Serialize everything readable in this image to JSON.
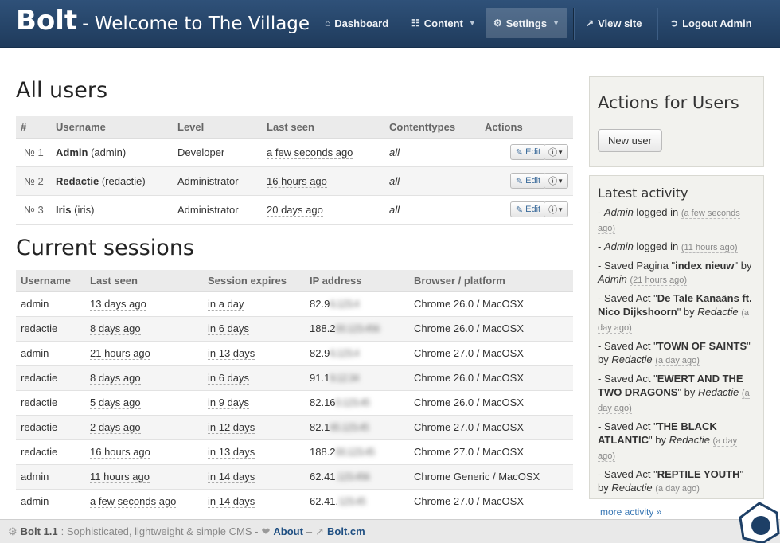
{
  "header": {
    "brand": "Bolt",
    "subtitle": "- Welcome to The Village",
    "nav": {
      "dashboard": "Dashboard",
      "content": "Content",
      "settings": "Settings",
      "view_site": "View site",
      "logout": "Logout Admin"
    }
  },
  "users": {
    "title": "All users",
    "columns": [
      "#",
      "Username",
      "Level",
      "Last seen",
      "Contenttypes",
      "Actions"
    ],
    "edit_label": "Edit",
    "rows": [
      {
        "num": "№ 1",
        "name": "Admin",
        "login": "(admin)",
        "level": "Developer",
        "last_seen": "a few seconds ago",
        "types": "all"
      },
      {
        "num": "№ 2",
        "name": "Redactie",
        "login": "(redactie)",
        "level": "Administrator",
        "last_seen": "16 hours ago",
        "types": "all"
      },
      {
        "num": "№ 3",
        "name": "Iris",
        "login": "(iris)",
        "level": "Administrator",
        "last_seen": "20 days ago",
        "types": "all"
      }
    ]
  },
  "sessions": {
    "title": "Current sessions",
    "columns": [
      "Username",
      "Last seen",
      "Session expires",
      "IP address",
      "Browser / platform"
    ],
    "rows": [
      {
        "user": "admin",
        "last_seen": "13 days ago",
        "expires": "in a day",
        "ip": "82.9",
        "ip_hidden": "6.123.4",
        "browser": "Chrome 26.0 / MacOSX"
      },
      {
        "user": "redactie",
        "last_seen": "8 days ago",
        "expires": "in 6 days",
        "ip": "188.2",
        "ip_hidden": "00.123.456",
        "browser": "Chrome 26.0 / MacOSX"
      },
      {
        "user": "admin",
        "last_seen": "21 hours ago",
        "expires": "in 13 days",
        "ip": "82.9",
        "ip_hidden": "6.123.4",
        "browser": "Chrome 27.0 / MacOSX"
      },
      {
        "user": "redactie",
        "last_seen": "8 days ago",
        "expires": "in 6 days",
        "ip": "91.1",
        "ip_hidden": "9.12.34",
        "browser": "Chrome 26.0 / MacOSX"
      },
      {
        "user": "redactie",
        "last_seen": "5 days ago",
        "expires": "in 9 days",
        "ip": "82.16",
        "ip_hidden": "0.123.45",
        "browser": "Chrome 26.0 / MacOSX"
      },
      {
        "user": "redactie",
        "last_seen": "2 days ago",
        "expires": "in 12 days",
        "ip": "82.1",
        "ip_hidden": "65.123.45",
        "browser": "Chrome 27.0 / MacOSX"
      },
      {
        "user": "redactie",
        "last_seen": "16 hours ago",
        "expires": "in 13 days",
        "ip": "188.2",
        "ip_hidden": "00.123.45",
        "browser": "Chrome 27.0 / MacOSX"
      },
      {
        "user": "admin",
        "last_seen": "11 hours ago",
        "expires": "in 14 days",
        "ip": "62.41",
        "ip_hidden": ".123.456",
        "browser": "Chrome Generic / MacOSX"
      },
      {
        "user": "admin",
        "last_seen": "a few seconds ago",
        "expires": "in 14 days",
        "ip": "62.41.",
        "ip_hidden": "123.45",
        "browser": "Chrome 27.0 / MacOSX"
      }
    ]
  },
  "sidebar": {
    "actions_title": "Actions for Users",
    "new_user": "New user",
    "activity_title": "Latest activity",
    "more": "more activity »",
    "items": [
      {
        "pre": "- ",
        "who": "Admin",
        "mid": " logged in ",
        "time": "(a few seconds ago)"
      },
      {
        "pre": "- ",
        "who": "Admin",
        "mid": " logged in ",
        "time": "(11 hours ago)"
      },
      {
        "pre": "- Saved Pagina \"",
        "bold": "index nieuw",
        "post": "\" by ",
        "who": "Admin",
        "time": "(21 hours ago)"
      },
      {
        "pre": "- Saved Act \"",
        "bold": "De Tale Kanaäns ft. Nico Dijkshoorn",
        "post": "\" by ",
        "who": "Redactie",
        "time": "(a day ago)"
      },
      {
        "pre": "- Saved Act \"",
        "bold": "TOWN OF SAINTS",
        "post": "\" by ",
        "who": "Redactie",
        "time": "(a day ago)"
      },
      {
        "pre": "- Saved Act \"",
        "bold": "EWERT AND THE TWO DRAGONS",
        "post": "\" by ",
        "who": "Redactie",
        "time": "(a day ago)"
      },
      {
        "pre": "- Saved Act \"",
        "bold": "THE BLACK ATLANTIC",
        "post": "\" by ",
        "who": "Redactie",
        "time": "(a day ago)"
      },
      {
        "pre": "- Saved Act \"",
        "bold": "REPTILE YOUTH",
        "post": "\" by ",
        "who": "Redactie",
        "time": "(a day ago)"
      }
    ]
  },
  "footer": {
    "version": "Bolt 1.1",
    "tagline": ": Sophisticated, lightweight & simple CMS -",
    "about": "About",
    "dash": "–",
    "site": "Bolt.cm"
  }
}
